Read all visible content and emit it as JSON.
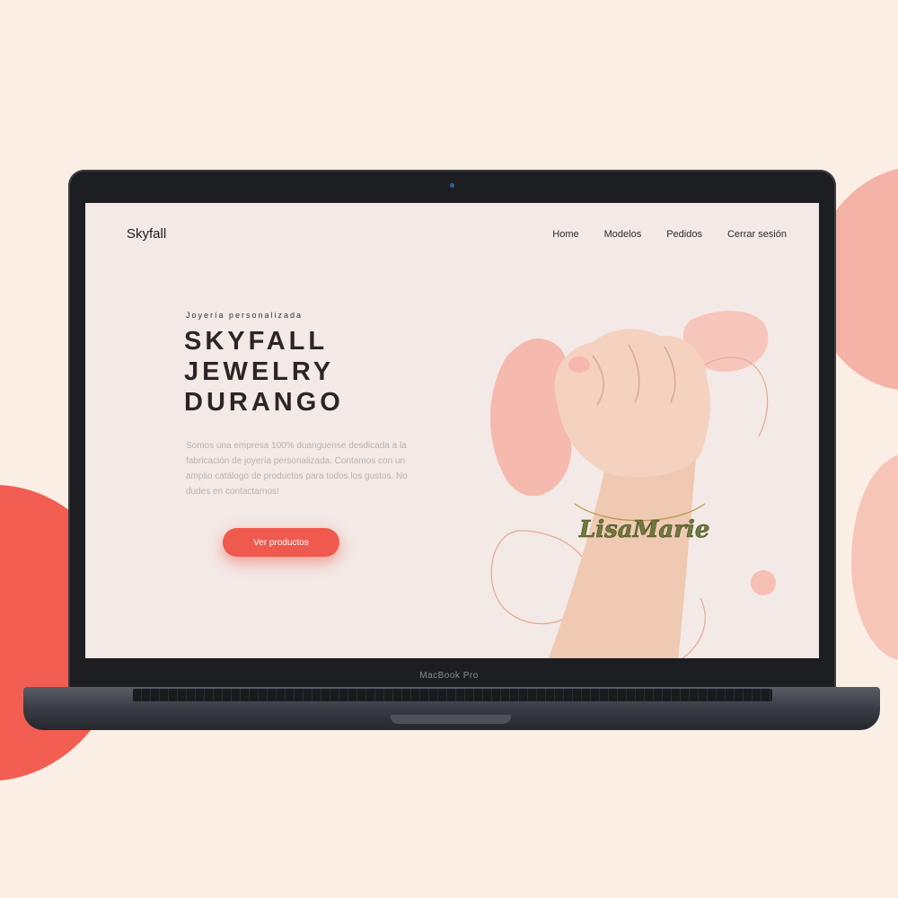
{
  "site": {
    "brand": "Skyfall",
    "nav": [
      "Home",
      "Modelos",
      "Pedidos",
      "Cerrar sesión"
    ]
  },
  "hero": {
    "eyebrow": "Joyería personalizada",
    "title_lines": [
      "SKYFALL",
      "JEWELRY",
      "DURANGO"
    ],
    "description": "Somos una empresa 100% duanguense desdicada a la fabricación de joyería personalizada. Contamos con un amplio catálogo de productos para todos los gustos. No dudes en contactarnos!",
    "cta_label": "Ver productos",
    "bracelet_text": "LisaMarie"
  },
  "device": {
    "label": "MacBook Pro"
  },
  "colors": {
    "accent": "#f0594e",
    "background": "#fbeee5",
    "screen": "#f3e9e6",
    "blob": "#f4b3a6"
  }
}
